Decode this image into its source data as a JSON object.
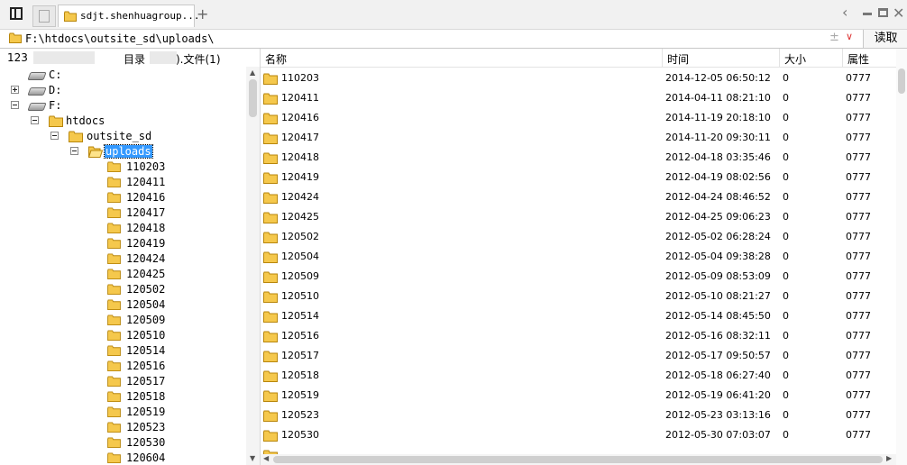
{
  "window": {
    "tab_title": "sdjt.shenhuagroup...",
    "new_tab_label": "+",
    "back_label": "‹"
  },
  "addressbar": {
    "path": "F:\\htdocs\\outsite_sd\\uploads\\",
    "extra_symbol": "±",
    "dropdown_symbol": "∨",
    "read_button": "读取"
  },
  "left_header": {
    "count_prefix": "123",
    "dir_label": "目录",
    "file_label": ").文件(1)"
  },
  "tree": {
    "drives": [
      {
        "label": "C:",
        "expander": "none"
      },
      {
        "label": "D:",
        "expander": "plus"
      },
      {
        "label": "F:",
        "expander": "minus"
      }
    ],
    "htdocs": "htdocs",
    "outsite_sd": "outsite_sd",
    "uploads": "uploads",
    "children": [
      "110203",
      "120411",
      "120416",
      "120417",
      "120418",
      "120419",
      "120424",
      "120425",
      "120502",
      "120504",
      "120509",
      "120510",
      "120514",
      "120516",
      "120517",
      "120518",
      "120519",
      "120523",
      "120530",
      "120604"
    ]
  },
  "columns": {
    "name": "名称",
    "time": "时间",
    "size": "大小",
    "attr": "属性"
  },
  "rows": [
    {
      "name": "110203",
      "time": "2014-12-05 06:50:12",
      "size": "0",
      "attr": "0777"
    },
    {
      "name": "120411",
      "time": "2014-04-11 08:21:10",
      "size": "0",
      "attr": "0777"
    },
    {
      "name": "120416",
      "time": "2014-11-19 20:18:10",
      "size": "0",
      "attr": "0777"
    },
    {
      "name": "120417",
      "time": "2014-11-20 09:30:11",
      "size": "0",
      "attr": "0777"
    },
    {
      "name": "120418",
      "time": "2012-04-18 03:35:46",
      "size": "0",
      "attr": "0777"
    },
    {
      "name": "120419",
      "time": "2012-04-19 08:02:56",
      "size": "0",
      "attr": "0777"
    },
    {
      "name": "120424",
      "time": "2012-04-24 08:46:52",
      "size": "0",
      "attr": "0777"
    },
    {
      "name": "120425",
      "time": "2012-04-25 09:06:23",
      "size": "0",
      "attr": "0777"
    },
    {
      "name": "120502",
      "time": "2012-05-02 06:28:24",
      "size": "0",
      "attr": "0777"
    },
    {
      "name": "120504",
      "time": "2012-05-04 09:38:28",
      "size": "0",
      "attr": "0777"
    },
    {
      "name": "120509",
      "time": "2012-05-09 08:53:09",
      "size": "0",
      "attr": "0777"
    },
    {
      "name": "120510",
      "time": "2012-05-10 08:21:27",
      "size": "0",
      "attr": "0777"
    },
    {
      "name": "120514",
      "time": "2012-05-14 08:45:50",
      "size": "0",
      "attr": "0777"
    },
    {
      "name": "120516",
      "time": "2012-05-16 08:32:11",
      "size": "0",
      "attr": "0777"
    },
    {
      "name": "120517",
      "time": "2012-05-17 09:50:57",
      "size": "0",
      "attr": "0777"
    },
    {
      "name": "120518",
      "time": "2012-05-18 06:27:40",
      "size": "0",
      "attr": "0777"
    },
    {
      "name": "120519",
      "time": "2012-05-19 06:41:20",
      "size": "0",
      "attr": "0777"
    },
    {
      "name": "120523",
      "time": "2012-05-23 03:13:16",
      "size": "0",
      "attr": "0777"
    },
    {
      "name": "120530",
      "time": "2012-05-30 07:03:07",
      "size": "0",
      "attr": "0777"
    }
  ],
  "icons": {
    "folder_color": "#f5c84c",
    "selection_color": "#3399ff"
  }
}
